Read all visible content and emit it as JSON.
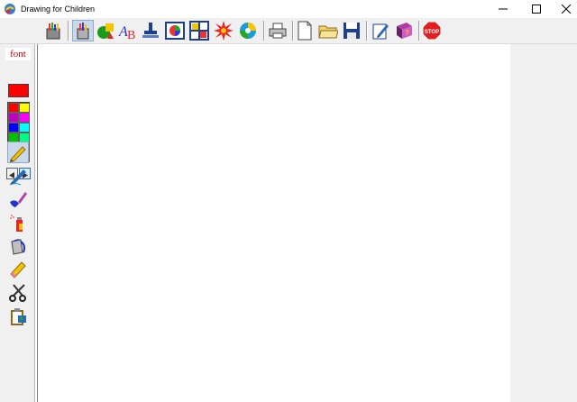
{
  "window": {
    "title": "Drawing for Children",
    "controls": {
      "minimize": "minimize",
      "maximize": "maximize",
      "close": "close"
    }
  },
  "toolbar": {
    "buttons": [
      {
        "name": "bucket-of-tools",
        "icon": "tools-bucket-icon"
      },
      {
        "name": "paint-pot",
        "icon": "paint-pot-icon",
        "pressed": true
      },
      {
        "name": "shapes",
        "icon": "shapes-icon"
      },
      {
        "name": "text",
        "icon": "text-ab-icon"
      },
      {
        "name": "stamp",
        "icon": "stamp-icon"
      },
      {
        "name": "picture-frame",
        "icon": "picture-icon"
      },
      {
        "name": "grid",
        "icon": "grid-icon"
      },
      {
        "name": "burst",
        "icon": "burst-icon"
      },
      {
        "name": "spiral",
        "icon": "spiral-icon"
      },
      {
        "name": "print",
        "icon": "printer-icon"
      },
      {
        "name": "new",
        "icon": "new-page-icon"
      },
      {
        "name": "open",
        "icon": "folder-icon"
      },
      {
        "name": "save",
        "icon": "floppy-icon"
      },
      {
        "name": "edit",
        "icon": "edit-icon"
      },
      {
        "name": "help-book",
        "icon": "help-book-icon"
      },
      {
        "name": "stop",
        "icon": "stop-sign-icon"
      }
    ],
    "stop_label": "STOP"
  },
  "left": {
    "font_label": "font",
    "current_color": "#ff0000",
    "palette": [
      "#ff0000",
      "#ffff00",
      "#c000c0",
      "#ff00ff",
      "#0000ff",
      "#00ffff",
      "#00c000",
      "#00ff80",
      "#008000",
      "#c0ff00",
      "#c0c0c0",
      "#000000"
    ],
    "tools": [
      {
        "name": "pencil",
        "icon": "pencil-icon",
        "selected": true
      },
      {
        "name": "pen",
        "icon": "pen-icon"
      },
      {
        "name": "brush",
        "icon": "brush-icon"
      },
      {
        "name": "spray",
        "icon": "spray-can-icon"
      },
      {
        "name": "fill",
        "icon": "fill-bucket-icon"
      },
      {
        "name": "eraser",
        "icon": "eraser-icon"
      },
      {
        "name": "scissors",
        "icon": "scissors-icon"
      },
      {
        "name": "clipboard",
        "icon": "clipboard-icon"
      }
    ]
  }
}
